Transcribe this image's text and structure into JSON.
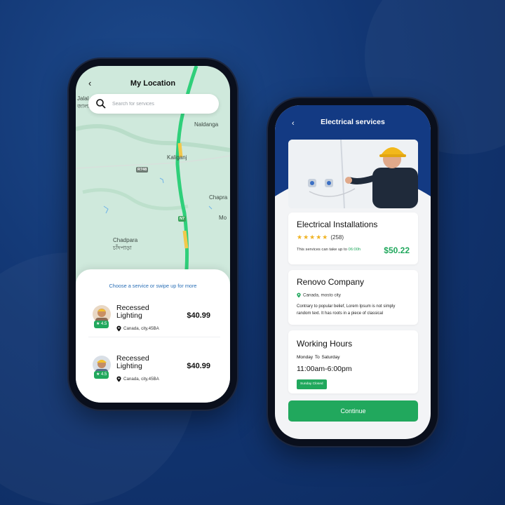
{
  "theme": {
    "background": "#123673",
    "accent_green": "#21a85d",
    "header_blue": "#133a83",
    "map_road": "#2fcf7a"
  },
  "location_screen": {
    "back_icon": "chevron-left-icon",
    "title": "My Location",
    "search": {
      "icon": "search-icon",
      "placeholder": "Search for services",
      "value": ""
    },
    "map_labels": [
      "Jalal",
      "জালা",
      "Naldanga",
      "Kaliganj",
      "R748",
      "Chapra",
      "N7",
      "Mo",
      "Chadpara",
      "চাঁদপাড়া"
    ],
    "hint": "Choose a service or swipe up for more",
    "services": [
      {
        "name": "Recessed Lighting",
        "rating": "4.5",
        "price": "$40.99",
        "location": "Canada, city,45BA"
      },
      {
        "name": "Recessed Lighting",
        "rating": "4.5",
        "price": "$40.99",
        "location": "Canada, city,45BA"
      }
    ]
  },
  "service_screen": {
    "back_icon": "chevron-left-icon",
    "title": "Electrical services",
    "service": {
      "title": "Electrical Installations",
      "stars": "★★★★★",
      "review_count": "(258)",
      "duration_note": "This services can take up to",
      "duration": "06:00h",
      "price": "$50.22"
    },
    "company": {
      "name": "Renovo Company",
      "location": "Canada, mosto city",
      "description": "Contrary to popular belief, Lorem Ipsum is not simply random text. It has roots in a piece of classical"
    },
    "hours": {
      "title": "Working Hours",
      "days": "Monday  To  Saturday",
      "time": "11:00am-6:00pm",
      "closed_tag": "Sunday Closed"
    },
    "continue_label": "Continue"
  }
}
